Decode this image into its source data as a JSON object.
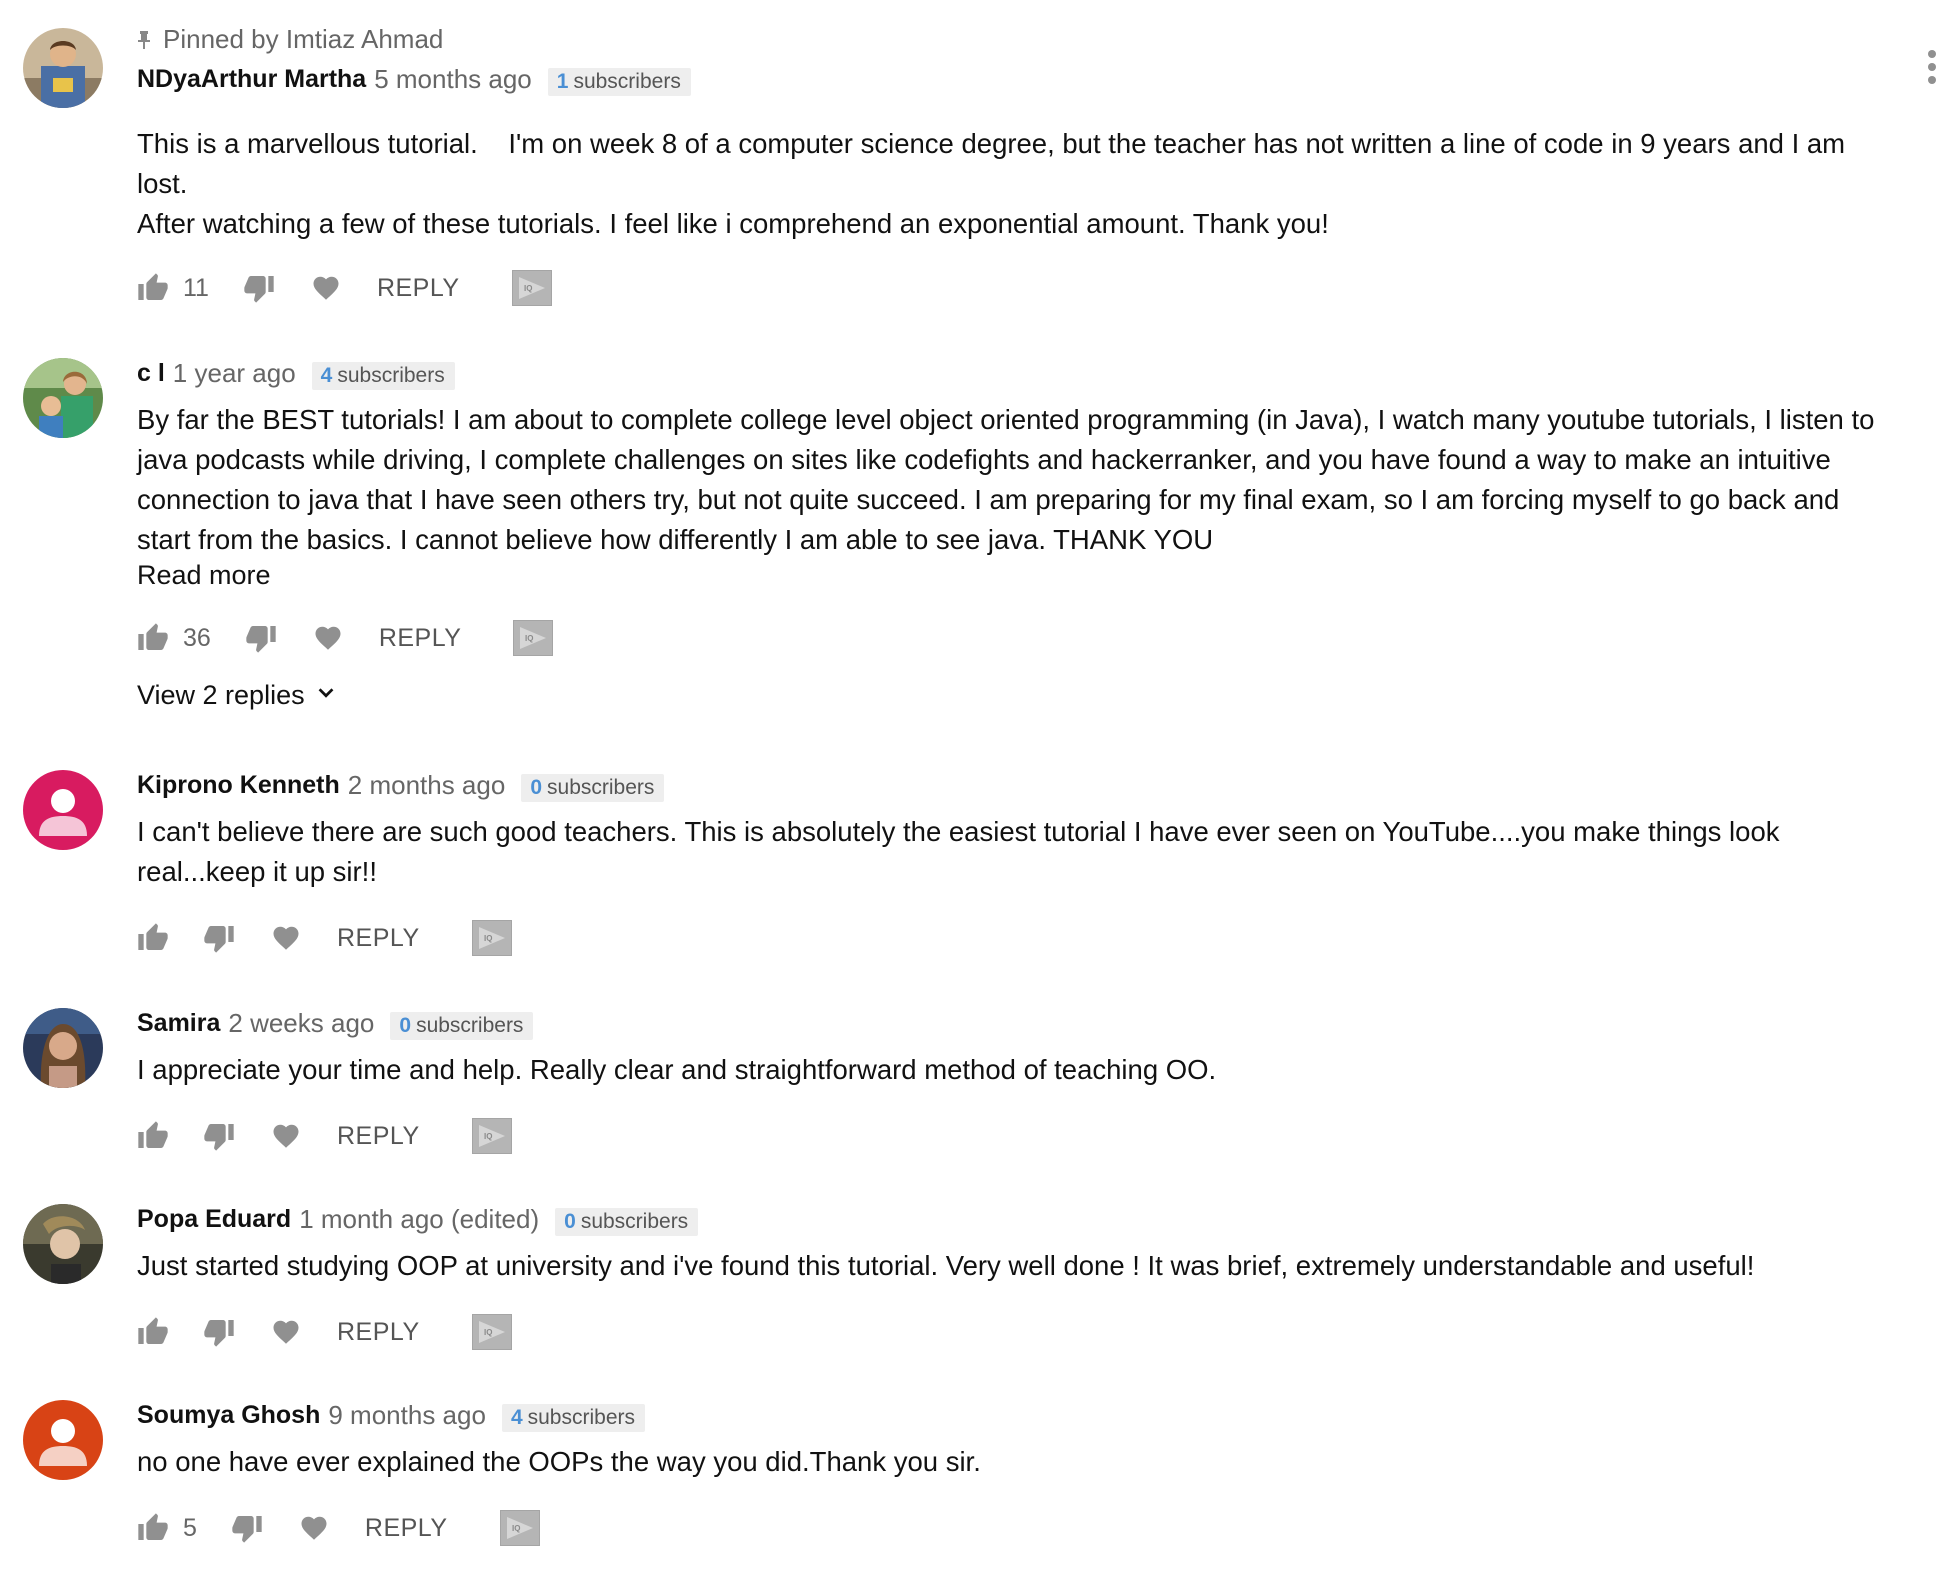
{
  "pinned_label": "Pinned by Imtiaz Ahmad",
  "colors": {
    "subscriber_count": "#4a8fd4",
    "avatar_pink": "#d81b60",
    "avatar_red": "#d84315"
  },
  "icons": {
    "like": "thumb-up-icon",
    "dislike": "thumb-down-icon",
    "heart": "heart-icon",
    "iq": "iq-icon",
    "menu": "more-vert-icon",
    "pin": "pin-icon",
    "chevron": "chevron-down-icon"
  },
  "comments": [
    {
      "author": "NDyaArthur Martha",
      "time": "5 months ago",
      "subs_count": "1",
      "subs_label": "subscribers",
      "text": "This is a marvellous tutorial.    I'm on week 8 of a computer science degree, but the teacher has not written a line of code in 9 years and I am lost.\nAfter watching a few of these tutorials. I feel like i comprehend an exponential amount. Thank you!",
      "likes": "11",
      "reply": "REPLY"
    },
    {
      "author": "c l",
      "time": "1 year ago",
      "subs_count": "4",
      "subs_label": "subscribers",
      "text": "By far the BEST tutorials! I am about to complete college level object oriented programming (in Java), I watch many youtube tutorials, I listen to java podcasts while driving, I complete challenges on sites like codefights and hackerranker, and you have found a way to make an intuitive connection to java that I have seen others try, but not quite succeed. I am preparing for my final exam, so I am forcing myself to go back and start from the basics. I cannot believe how differently I am able to see java. THANK YOU",
      "read_more": "Read more",
      "likes": "36",
      "reply": "REPLY",
      "view_replies": "View 2 replies"
    },
    {
      "author": "Kiprono Kenneth",
      "time": "2 months ago",
      "subs_count": "0",
      "subs_label": "subscribers",
      "text": "I can't believe there are such good teachers. This is absolutely the easiest tutorial I have ever seen on YouTube....you make things look real...keep it up sir!!",
      "reply": "REPLY"
    },
    {
      "author": "Samira",
      "time": "2 weeks ago",
      "subs_count": "0",
      "subs_label": "subscribers",
      "text": "I appreciate your time and help. Really clear and straightforward method of teaching OO.",
      "reply": "REPLY"
    },
    {
      "author": "Popa Eduard",
      "time": "1 month ago (edited)",
      "subs_count": "0",
      "subs_label": "subscribers",
      "text": "Just started studying OOP at university and i've found this tutorial. Very well done ! It was brief, extremely understandable and useful!",
      "reply": "REPLY"
    },
    {
      "author": "Soumya Ghosh",
      "time": "9 months ago",
      "subs_count": "4",
      "subs_label": "subscribers",
      "text": "no one have ever explained the OOPs the way you did.Thank you sir.",
      "likes": "5",
      "reply": "REPLY"
    }
  ]
}
